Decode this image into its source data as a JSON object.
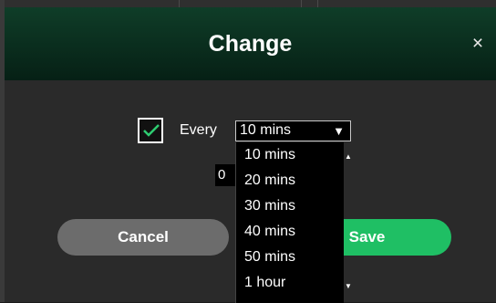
{
  "dialog": {
    "title": "Change",
    "close_label": "×"
  },
  "schedule": {
    "checkbox_checked": true,
    "every_label": "Every",
    "selected_interval": "10 mins",
    "select_arrow": "▼",
    "number_value": "0"
  },
  "dropdown": {
    "options": [
      "10 mins",
      "20 mins",
      "30 mins",
      "40 mins",
      "50 mins",
      "1 hour"
    ]
  },
  "buttons": {
    "cancel_label": "Cancel",
    "save_label": "Save"
  },
  "colors": {
    "header_top": "#0f3d28",
    "header_bottom": "#062015",
    "save_green": "#1fbf64",
    "cancel_gray": "#6c6c6c",
    "checkmark_green": "#2ecc71"
  }
}
